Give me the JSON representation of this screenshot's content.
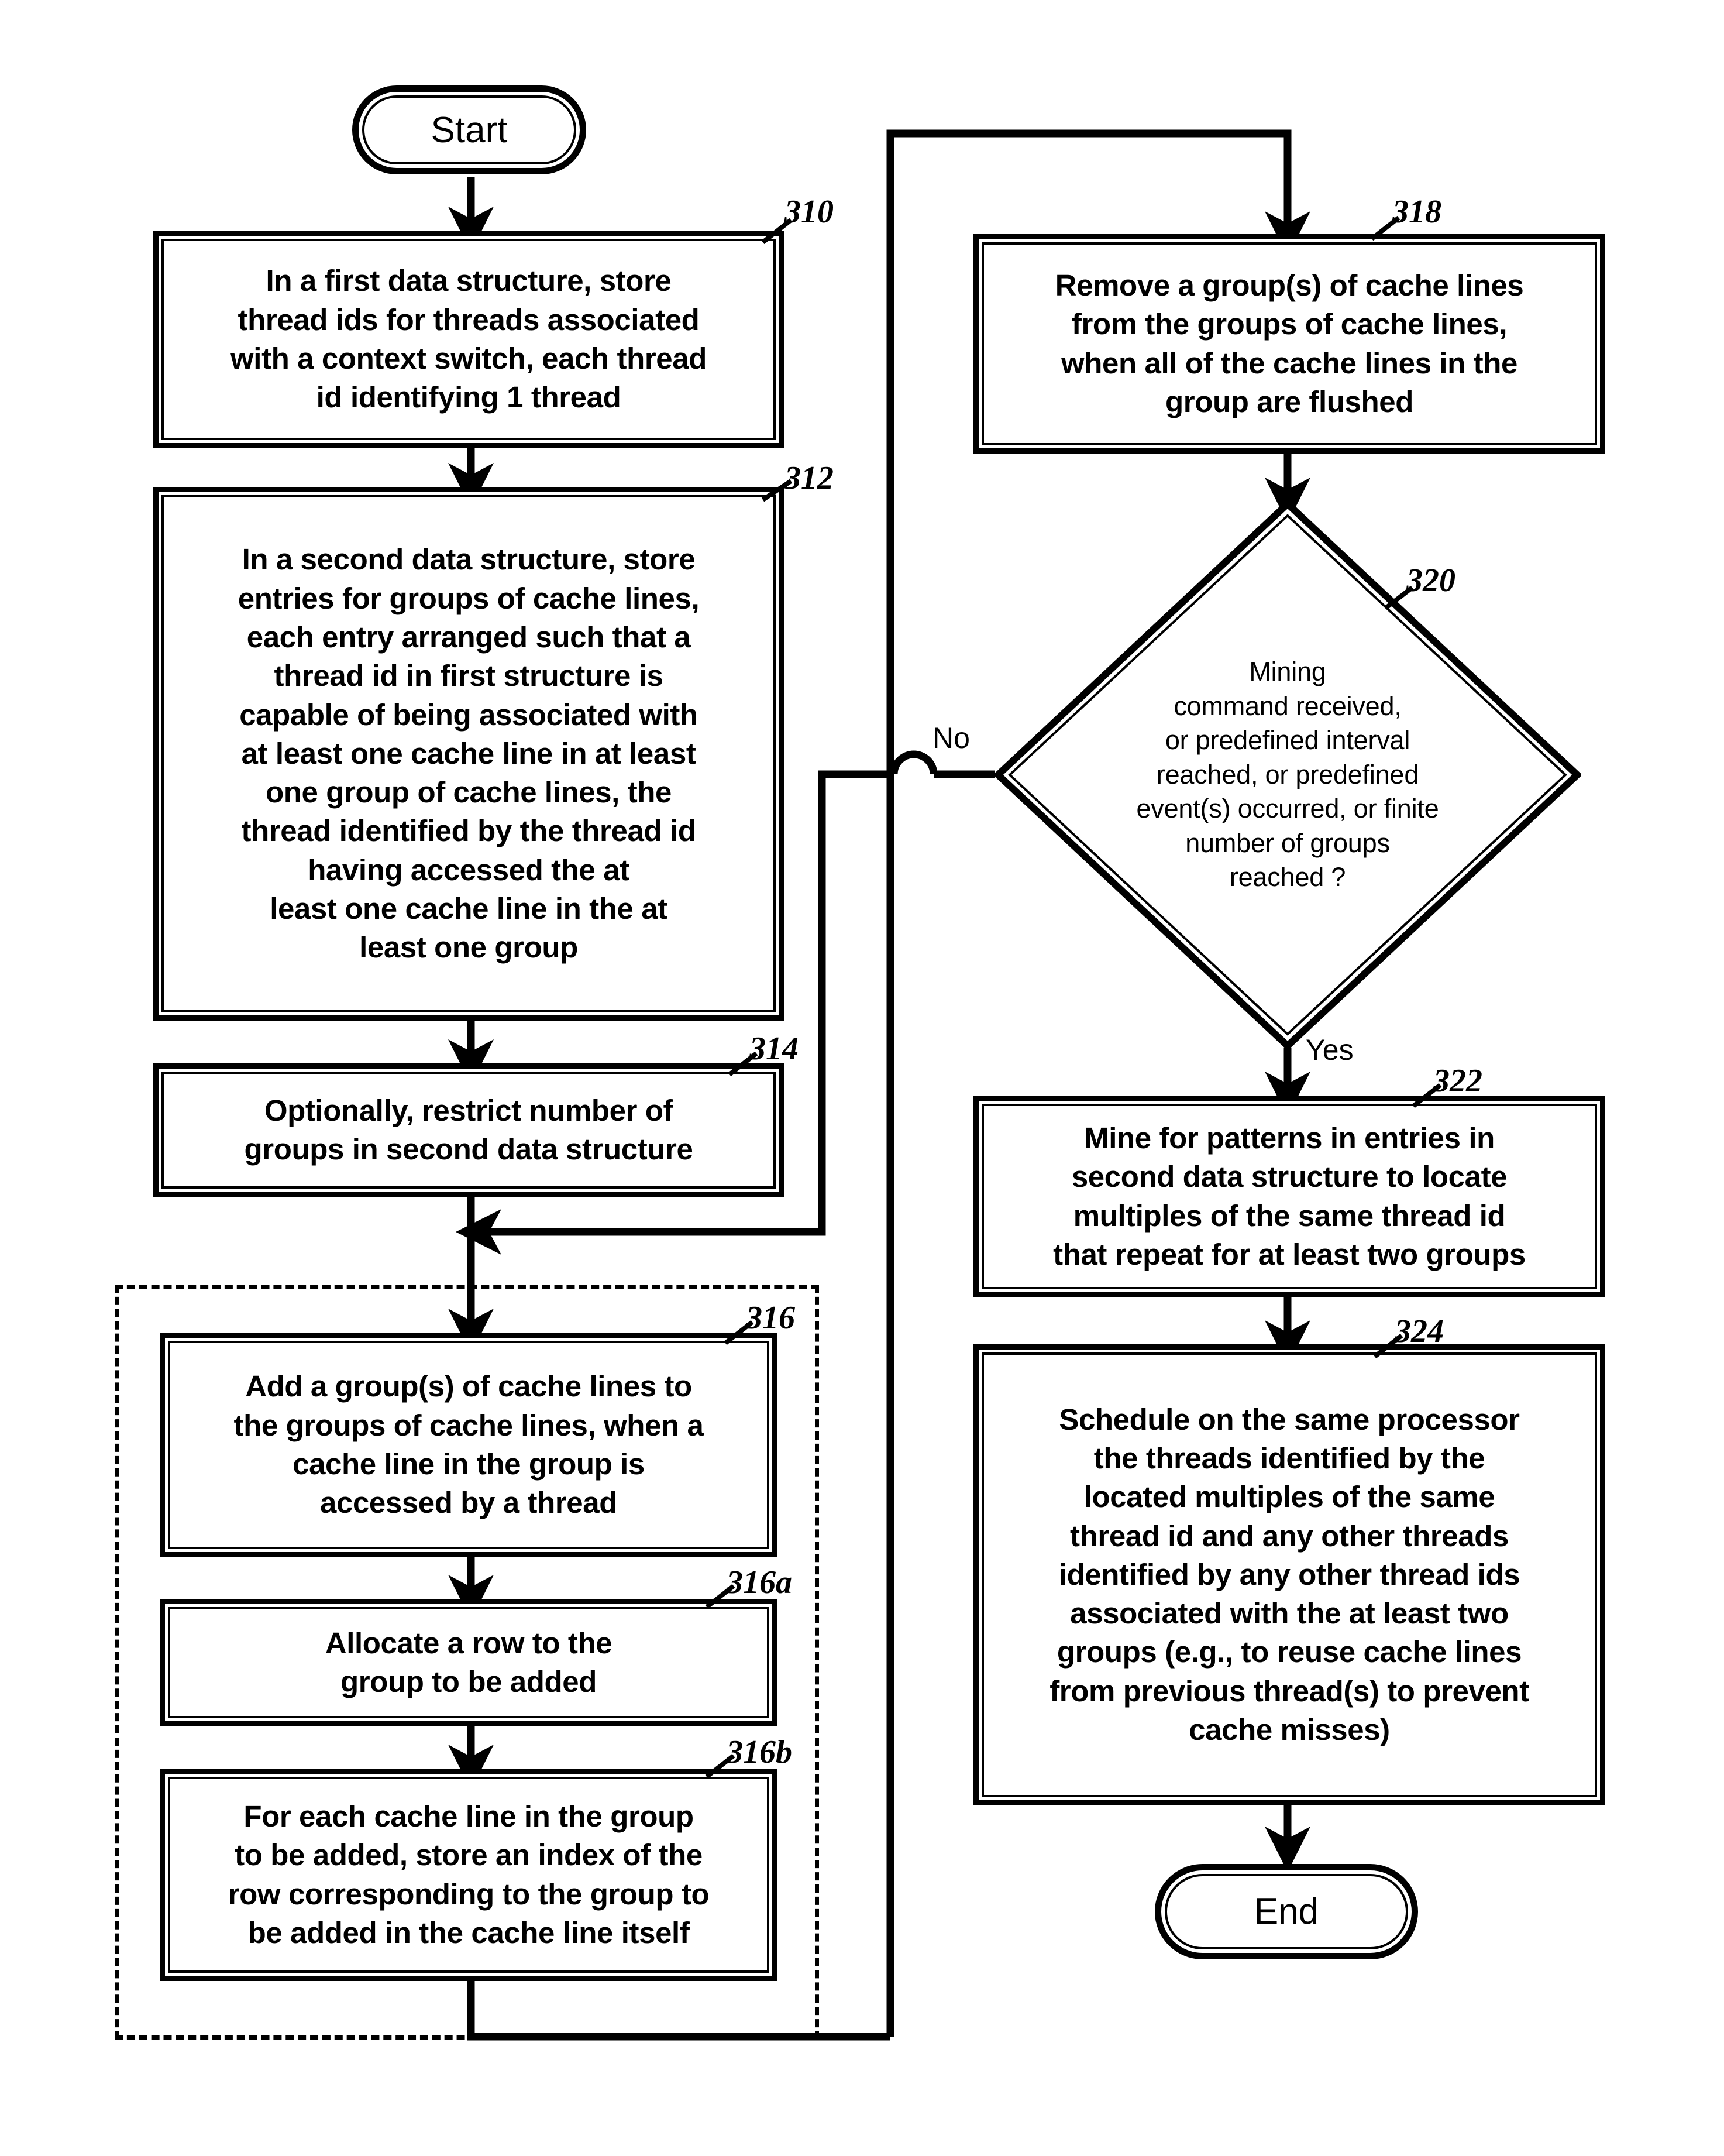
{
  "figure": {
    "type": "flowchart",
    "orientation": "two-column",
    "start_label": "Start",
    "end_label": "End",
    "branch_no": "No",
    "branch_yes": "Yes"
  },
  "nodes": {
    "n310": {
      "ref": "310",
      "shape": "process",
      "lines": [
        "In a first data structure, store",
        "thread ids for threads associated",
        "with a context switch, each thread",
        "id identifying 1 thread"
      ]
    },
    "n312": {
      "ref": "312",
      "shape": "process",
      "lines": [
        "In a second data structure, store",
        "entries for groups of cache lines,",
        "each entry arranged such that a",
        "thread id in first structure is",
        "capable of being associated with",
        "at least one cache line in at least",
        "one group of cache lines, the",
        "thread identified by the thread id",
        "having accessed the at",
        "least one cache line in the at",
        "least one group"
      ]
    },
    "n314": {
      "ref": "314",
      "shape": "process",
      "lines": [
        "Optionally, restrict number of",
        "groups in second data structure"
      ]
    },
    "n316": {
      "ref": "316",
      "shape": "process",
      "lines": [
        "Add a group(s) of cache lines to",
        "the groups of cache lines, when a",
        "cache line in the group is",
        "accessed by a thread"
      ]
    },
    "n316a": {
      "ref": "316a",
      "shape": "process",
      "lines": [
        "Allocate a row to the",
        "group to be added"
      ]
    },
    "n316b": {
      "ref": "316b",
      "shape": "process",
      "lines": [
        "For each cache line in the group",
        "to be added, store an index of the",
        "row corresponding to the group to",
        "be added in the cache line itself"
      ]
    },
    "n318": {
      "ref": "318",
      "shape": "process",
      "lines": [
        "Remove a group(s) of cache lines",
        "from the groups of cache lines,",
        "when all of the cache lines in the",
        "group are flushed"
      ]
    },
    "n320": {
      "ref": "320",
      "shape": "decision",
      "lines": [
        "Mining",
        "command received,",
        "or predefined interval",
        "reached, or predefined",
        "event(s) occurred, or finite",
        "number of groups",
        "reached ?"
      ]
    },
    "n322": {
      "ref": "322",
      "shape": "process",
      "lines": [
        "Mine for patterns in entries in",
        "second data structure to locate",
        "multiples of the same thread id",
        "that repeat for at least two groups"
      ]
    },
    "n324": {
      "ref": "324",
      "shape": "process",
      "lines": [
        "Schedule on the same processor",
        "the threads identified by the",
        "located multiples of the same",
        "thread id and any other threads",
        "identified by any other thread ids",
        "associated with the at least two",
        "groups (e.g., to reuse cache lines",
        "from previous thread(s) to prevent",
        "cache misses)"
      ]
    }
  },
  "colors": {
    "ink": "#000000",
    "paper": "#ffffff"
  }
}
